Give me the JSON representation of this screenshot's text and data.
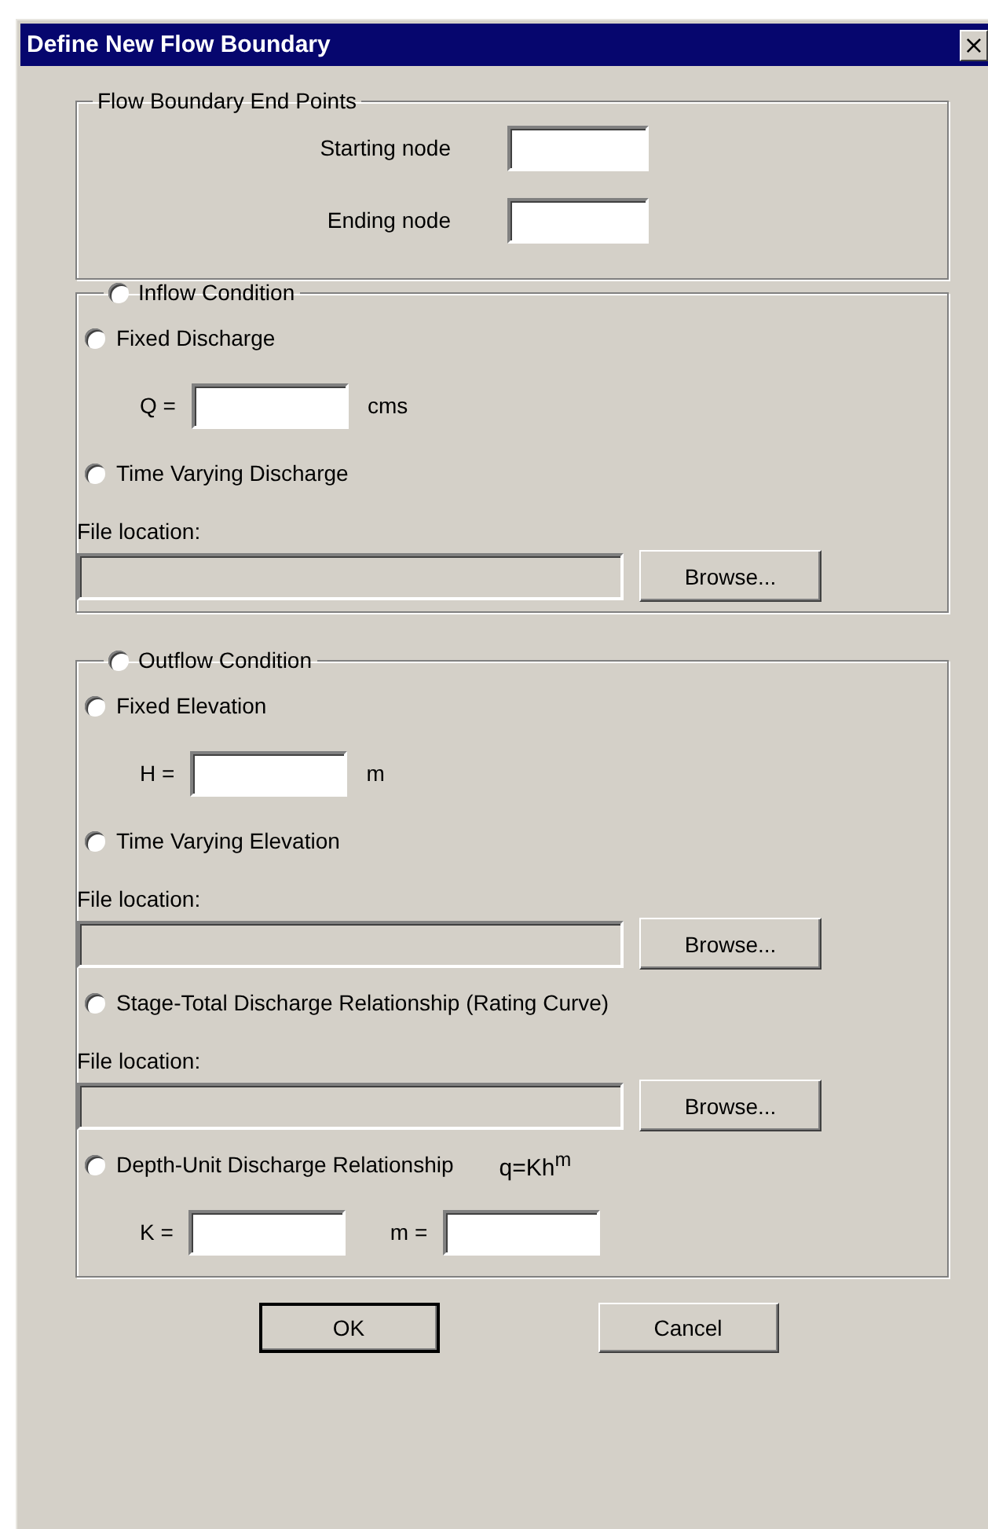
{
  "window": {
    "title": "Define New Flow Boundary",
    "close": "×"
  },
  "endpoints": {
    "title": "Flow Boundary End Points",
    "fields": [
      {
        "label": "Starting node"
      },
      {
        "label": "Ending node"
      }
    ]
  },
  "groups": [
    {
      "label": "Inflow Condition",
      "selected": false,
      "options": [
        {
          "kind": "value",
          "label": "Fixed Discharge",
          "selected": false,
          "field_label": "Q =",
          "unit": "cms"
        },
        {
          "kind": "file",
          "label": "Time Varying Discharge",
          "selected": false,
          "file_label": "File location:",
          "browse": "Browse..."
        }
      ]
    },
    {
      "label": "Outflow Condition",
      "selected": false,
      "options": [
        {
          "kind": "value",
          "label": "Fixed Elevation",
          "selected": false,
          "field_label": "H =",
          "unit": "m"
        },
        {
          "kind": "file",
          "label": "Time Varying Elevation",
          "selected": false,
          "file_label": "File location:",
          "browse": "Browse..."
        },
        {
          "kind": "file",
          "label": "Stage-Total Discharge Relationship (Rating Curve)",
          "selected": false,
          "file_label": "File location:",
          "browse": "Browse..."
        },
        {
          "kind": "coefficients",
          "label": "Depth-Unit Discharge Relationship",
          "selected": false,
          "formula": "q=Kh$^{m}$",
          "fields": [
            {
              "label": "K ="
            },
            {
              "label": "m ="
            }
          ]
        }
      ]
    }
  ],
  "buttons": [
    {
      "label": "OK",
      "default": true
    },
    {
      "label": "Cancel",
      "default": false
    }
  ]
}
